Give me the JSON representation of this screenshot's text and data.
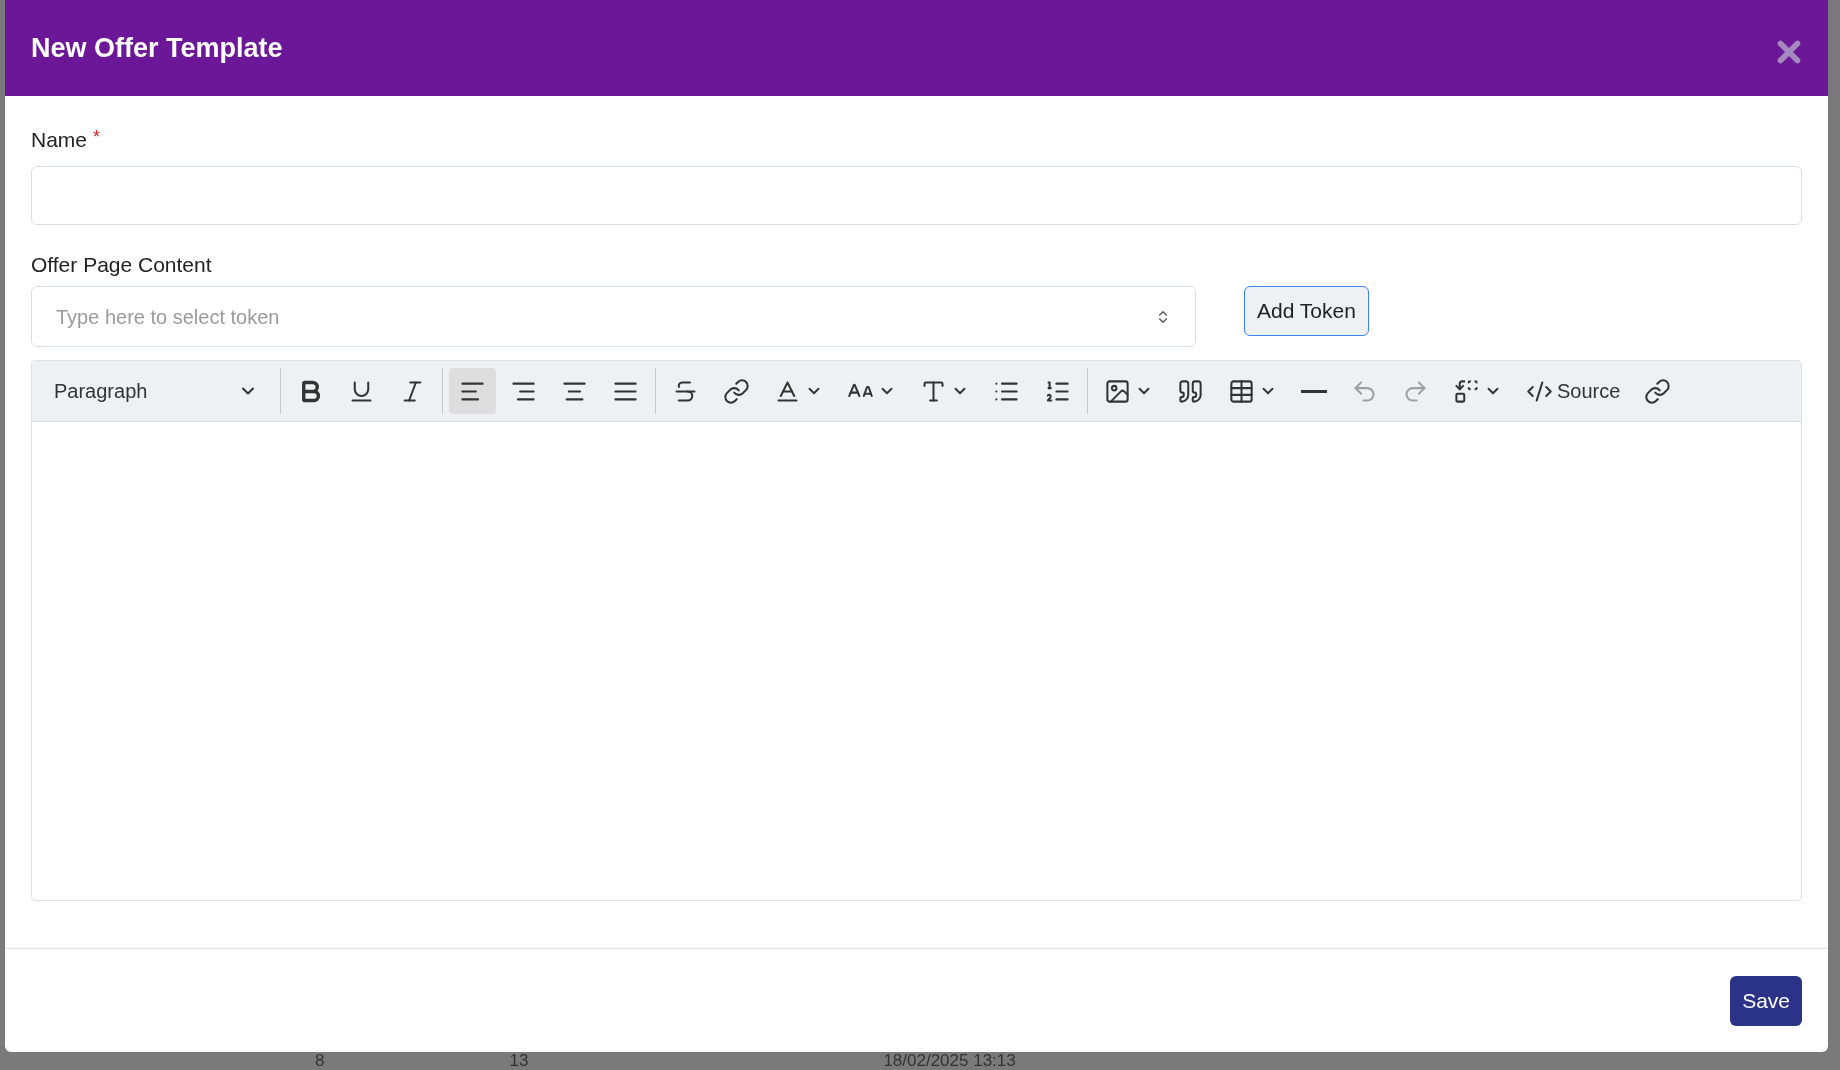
{
  "dialog": {
    "title": "New Offer Template"
  },
  "name_field": {
    "label": "Name",
    "required_mark": "*"
  },
  "content": {
    "label": "Offer Page Content",
    "token_select": {
      "placeholder": "Type here to select token"
    },
    "add_token_button": "Add Token"
  },
  "toolbar": [
    [
      {
        "kind": "heading",
        "label": "Paragraph",
        "dropdown": true
      }
    ],
    [
      {
        "kind": "bold",
        "selected": false,
        "disabled": false,
        "dropdown": false
      },
      {
        "kind": "underline",
        "selected": false,
        "disabled": false,
        "dropdown": false
      },
      {
        "kind": "italic",
        "selected": false,
        "disabled": false,
        "dropdown": false
      }
    ],
    [
      {
        "kind": "align-left",
        "selected": true,
        "disabled": false,
        "dropdown": false
      },
      {
        "kind": "align-right",
        "selected": false,
        "disabled": false,
        "dropdown": false
      },
      {
        "kind": "align-center",
        "selected": false,
        "disabled": false,
        "dropdown": false
      },
      {
        "kind": "align-justify",
        "selected": false,
        "disabled": false,
        "dropdown": false
      }
    ],
    [
      {
        "kind": "strikethrough",
        "selected": false,
        "disabled": false,
        "dropdown": false
      },
      {
        "kind": "link",
        "selected": false,
        "disabled": false,
        "dropdown": false
      },
      {
        "kind": "font-color",
        "selected": false,
        "disabled": false,
        "dropdown": true
      },
      {
        "kind": "font-size",
        "selected": false,
        "disabled": false,
        "dropdown": true
      },
      {
        "kind": "line-height",
        "selected": false,
        "disabled": false,
        "dropdown": true
      },
      {
        "kind": "bullet-list",
        "selected": false,
        "disabled": false,
        "dropdown": false
      },
      {
        "kind": "numbered-list",
        "selected": false,
        "disabled": false,
        "dropdown": false
      }
    ],
    [
      {
        "kind": "image",
        "selected": false,
        "disabled": false,
        "dropdown": true
      },
      {
        "kind": "quote",
        "selected": false,
        "disabled": false,
        "dropdown": false
      },
      {
        "kind": "table",
        "selected": false,
        "disabled": false,
        "dropdown": true
      },
      {
        "kind": "horizontal-line",
        "selected": false,
        "disabled": false,
        "dropdown": false
      },
      {
        "kind": "undo",
        "selected": false,
        "disabled": true,
        "dropdown": false
      },
      {
        "kind": "redo",
        "selected": false,
        "disabled": true,
        "dropdown": false
      },
      {
        "kind": "find-replace",
        "selected": false,
        "disabled": false,
        "dropdown": true
      },
      {
        "kind": "source",
        "label": "Source",
        "selected": false,
        "disabled": false,
        "dropdown": false
      },
      {
        "kind": "link",
        "selected": false,
        "disabled": false,
        "dropdown": false
      }
    ]
  ],
  "footer": {
    "buttons": [
      "Save"
    ]
  },
  "background_row": [
    "8",
    "13",
    "18/02/2025 13:13"
  ]
}
